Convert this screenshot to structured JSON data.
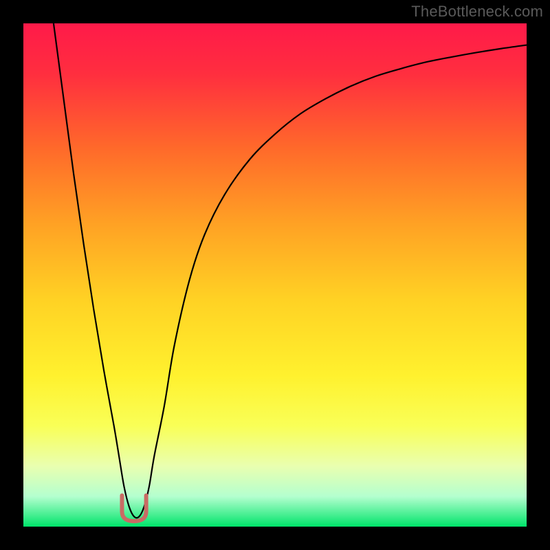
{
  "watermark": "TheBottleneck.com",
  "chart_data": {
    "type": "line",
    "title": "",
    "xlabel": "",
    "ylabel": "",
    "xlim": [
      0,
      100
    ],
    "ylim": [
      0,
      100
    ],
    "grid": false,
    "background_gradient": {
      "stops": [
        {
          "pos": 0.0,
          "color": "#ff1a49"
        },
        {
          "pos": 0.1,
          "color": "#ff2e3f"
        },
        {
          "pos": 0.25,
          "color": "#ff6a2a"
        },
        {
          "pos": 0.4,
          "color": "#ffa224"
        },
        {
          "pos": 0.55,
          "color": "#ffd224"
        },
        {
          "pos": 0.7,
          "color": "#fff12e"
        },
        {
          "pos": 0.8,
          "color": "#f9ff57"
        },
        {
          "pos": 0.88,
          "color": "#e9ffb0"
        },
        {
          "pos": 0.94,
          "color": "#b4ffcf"
        },
        {
          "pos": 1.0,
          "color": "#00e46a"
        }
      ]
    },
    "series": [
      {
        "name": "bottleneck-curve",
        "color": "#000000",
        "x": [
          6,
          8,
          10,
          12,
          14,
          16,
          18,
          19,
          20,
          21,
          22,
          23,
          24,
          25,
          26,
          28,
          30,
          33,
          36,
          40,
          45,
          50,
          55,
          60,
          65,
          70,
          75,
          80,
          85,
          90,
          95,
          100
        ],
        "y": [
          100,
          85,
          70,
          56,
          43,
          31,
          20,
          14,
          8,
          4,
          2,
          2,
          4,
          8,
          14,
          24,
          36,
          49,
          58,
          66,
          73,
          78,
          82,
          85,
          87.5,
          89.5,
          91,
          92.3,
          93.3,
          94.2,
          95,
          95.7
        ]
      }
    ],
    "marker": {
      "name": "optimal-point",
      "x": 22,
      "y": 3,
      "rx": 2.4,
      "ry": 3.2,
      "color": "#c96b64"
    }
  }
}
